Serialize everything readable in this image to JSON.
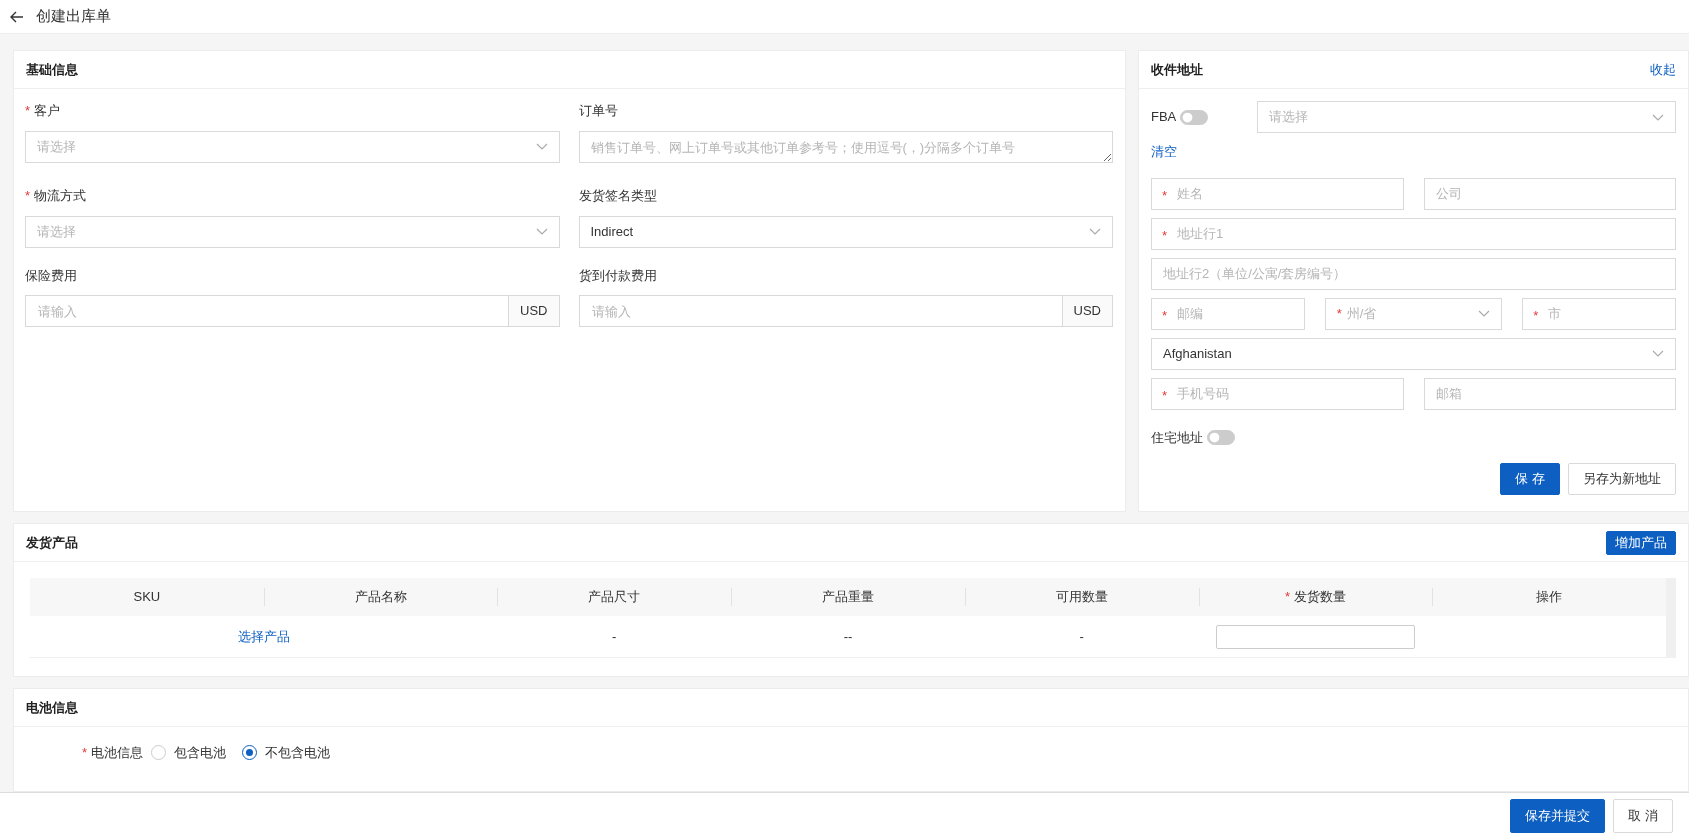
{
  "page": {
    "title": "创建出库单"
  },
  "basic_info": {
    "title": "基础信息",
    "fields": [
      {
        "label": "客户",
        "required_mark": "*",
        "kind": "select",
        "placeholder": "请选择"
      },
      {
        "label": "订单号",
        "kind": "textarea",
        "placeholder": "销售订单号、网上订单号或其他订单参考号；使用逗号(，)分隔多个订单号"
      },
      {
        "label": "物流方式",
        "required_mark": "*",
        "kind": "select",
        "placeholder": "请选择"
      },
      {
        "label": "发货签名类型",
        "kind": "select",
        "value": "Indirect"
      },
      {
        "label": "保险费用",
        "kind": "money",
        "placeholder": "请输入",
        "unit": "USD"
      },
      {
        "label": "货到付款费用",
        "kind": "money",
        "placeholder": "请输入",
        "unit": "USD"
      }
    ]
  },
  "address": {
    "title": "收件地址",
    "collapse_link": "收起",
    "fba": {
      "label": "FBA",
      "on": false,
      "select_placeholder": "请选择"
    },
    "clear_link": "清空",
    "rows": [
      [
        {
          "kind": "input",
          "required_mark": "*",
          "placeholder": "姓名"
        },
        {
          "kind": "input",
          "placeholder": "公司"
        }
      ],
      [
        {
          "kind": "input",
          "required_mark": "*",
          "placeholder": "地址行1"
        }
      ],
      [
        {
          "kind": "input",
          "placeholder": "地址行2（单位/公寓/套房编号）"
        }
      ],
      [
        {
          "kind": "input",
          "required_mark": "*",
          "placeholder": "邮编"
        },
        {
          "kind": "select",
          "required_mark": "*",
          "placeholder": "州/省"
        },
        {
          "kind": "input",
          "required_mark": "*",
          "placeholder": "市"
        }
      ],
      [
        {
          "kind": "select",
          "value": "Afghanistan"
        }
      ],
      [
        {
          "kind": "input",
          "required_mark": "*",
          "placeholder": "手机号码"
        },
        {
          "kind": "input",
          "placeholder": "邮箱"
        }
      ]
    ],
    "residential": {
      "label": "住宅地址",
      "on": false
    },
    "buttons": [
      {
        "label": "保 存",
        "kind": "primary"
      },
      {
        "label": "另存为新地址",
        "kind": "default"
      }
    ]
  },
  "products": {
    "title": "发货产品",
    "add_button": "增加产品",
    "columns": [
      {
        "label": "SKU"
      },
      {
        "label": "产品名称"
      },
      {
        "label": "产品尺寸"
      },
      {
        "label": "产品重量"
      },
      {
        "label": "可用数量"
      },
      {
        "label": "发货数量",
        "required_mark": "*"
      },
      {
        "label": "操作"
      }
    ],
    "rows": [
      {
        "cells": [
          {
            "kind": "link",
            "text": "选择产品"
          },
          {
            "kind": "empty"
          },
          {
            "kind": "text",
            "text": "-"
          },
          {
            "kind": "text",
            "text": "--"
          },
          {
            "kind": "text",
            "text": "-"
          },
          {
            "kind": "input"
          },
          {
            "kind": "empty"
          }
        ]
      }
    ]
  },
  "battery": {
    "title": "电池信息",
    "label": "电池信息",
    "required_mark": "*",
    "options": [
      {
        "label": "包含电池",
        "selected": false
      },
      {
        "label": "不包含电池",
        "selected": true
      }
    ]
  },
  "footer": {
    "buttons": [
      {
        "label": "保存并提交",
        "kind": "primary"
      },
      {
        "label": "取 消",
        "kind": "default"
      }
    ]
  }
}
